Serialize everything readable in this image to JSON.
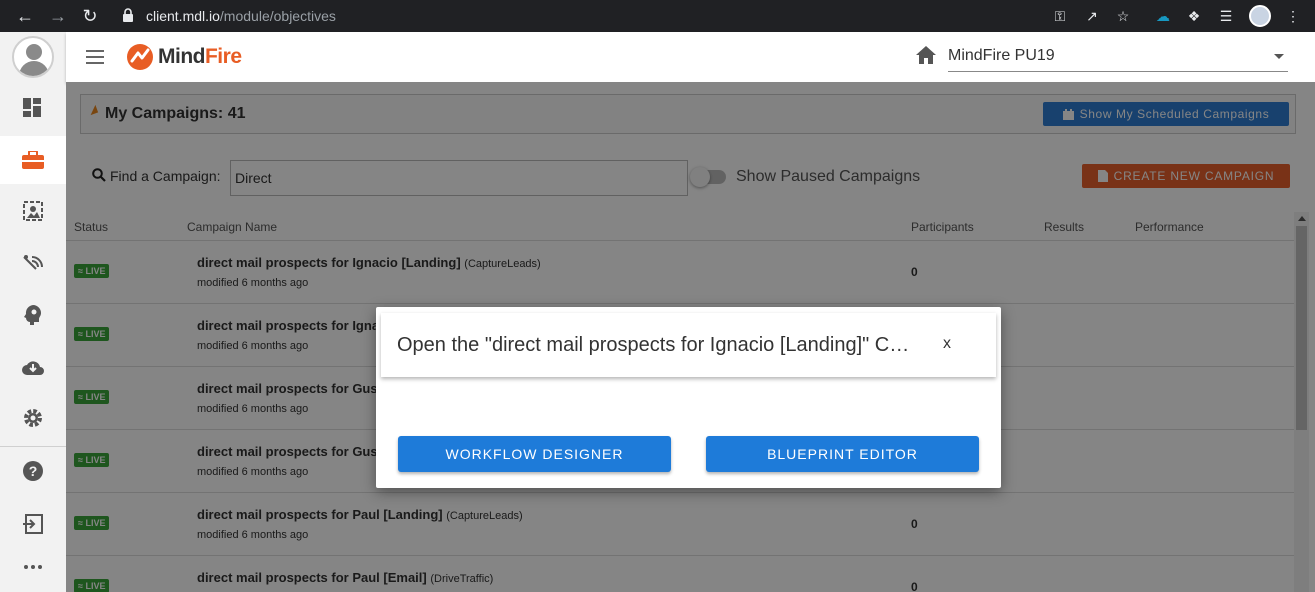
{
  "browser": {
    "url_host": "client.mdl.io",
    "url_path": "/module/objectives"
  },
  "header": {
    "logo_main": "Mind",
    "logo_accent": "Fire",
    "account": "MindFire PU19"
  },
  "campaigns": {
    "title": "My Campaigns: 41",
    "scheduled_button": "Show My Scheduled Campaigns",
    "find_label": "Find a Campaign:",
    "search_value": "Direct",
    "paused_label": "Show Paused Campaigns",
    "create_button": "CREATE NEW CAMPAIGN"
  },
  "table": {
    "columns": [
      "Status",
      "Campaign Name",
      "Participants",
      "Results",
      "Performance"
    ],
    "rows": [
      {
        "status": "LIVE",
        "name": "direct mail prospects for Ignacio [Landing]",
        "type": "(CaptureLeads)",
        "modified": "modified 6 months ago",
        "participants": "0"
      },
      {
        "status": "LIVE",
        "name": "direct mail prospects for Igna",
        "type": "",
        "modified": "modified 6 months ago",
        "participants": ""
      },
      {
        "status": "LIVE",
        "name": "direct mail prospects for Gus",
        "type": "",
        "modified": "modified 6 months ago",
        "participants": ""
      },
      {
        "status": "LIVE",
        "name": "direct mail prospects for Gus",
        "type": "",
        "modified": "modified 6 months ago",
        "participants": ""
      },
      {
        "status": "LIVE",
        "name": "direct mail prospects for Paul [Landing]",
        "type": "(CaptureLeads)",
        "modified": "modified 6 months ago",
        "participants": "0"
      },
      {
        "status": "LIVE",
        "name": "direct mail prospects for Paul [Email]",
        "type": "(DriveTraffic)",
        "modified": "",
        "participants": "0"
      }
    ]
  },
  "modal": {
    "title": "Open the \"direct mail prospects for Ignacio [Landing]\" Campaign in",
    "close": "x",
    "button_workflow": "WORKFLOW DESIGNER",
    "button_blueprint": "BLUEPRINT EDITOR"
  },
  "colors": {
    "accent": "#1e7bd9",
    "brand": "#e85d24",
    "live": "#3aa53a"
  }
}
